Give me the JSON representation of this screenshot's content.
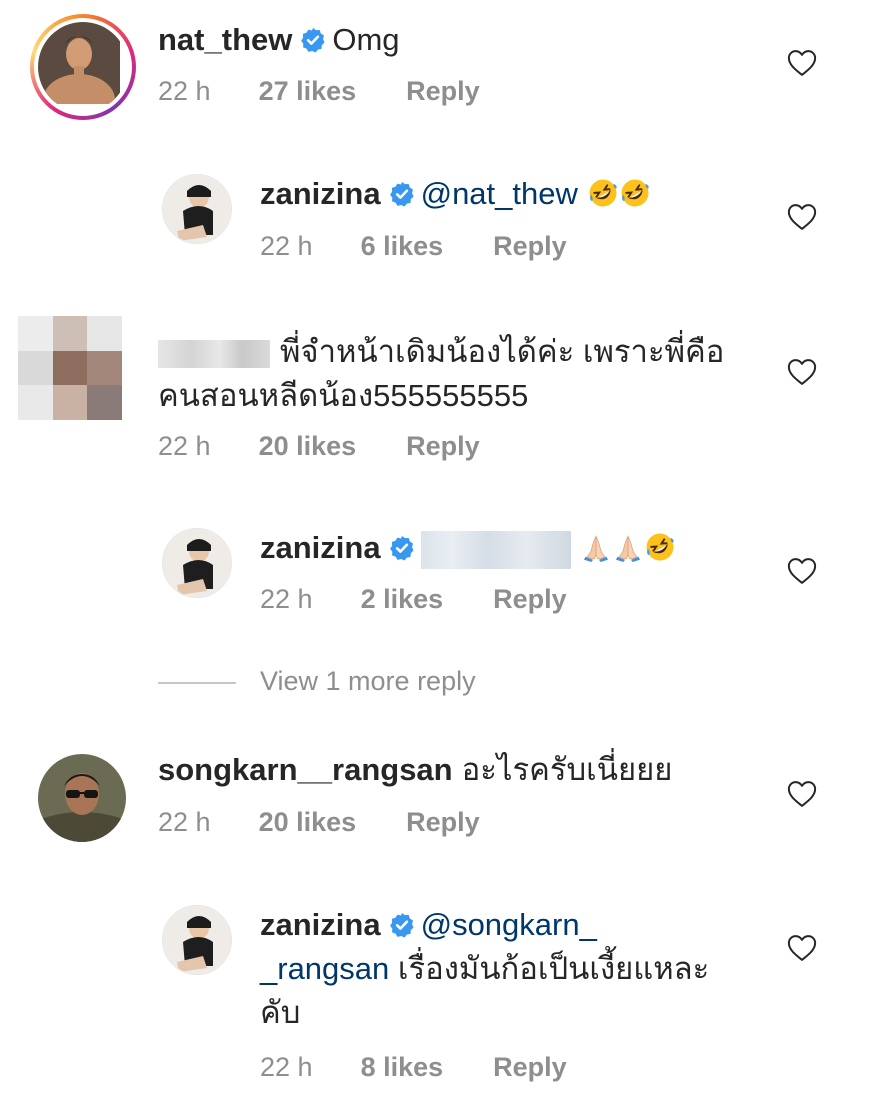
{
  "comments": [
    {
      "username": "nat_thew",
      "text": "Omg",
      "time": "22 h",
      "likes": "27 likes",
      "reply": "Reply"
    },
    {
      "username": "zanizina",
      "mention": "@nat_thew",
      "time": "22 h",
      "likes": "6 likes",
      "reply": "Reply",
      "emojis": [
        "rolling-on-floor-laughing",
        "rolling-on-floor-laughing"
      ]
    },
    {
      "text_line1": "พี่จำหน้าเดิมน้องได้ค่ะ เพราะพี่คือ",
      "text_line2": "คนสอนหลีดน้อง555555555",
      "time": "22 h",
      "likes": "20 likes",
      "reply": "Reply"
    },
    {
      "username": "zanizina",
      "time": "22 h",
      "likes": "2 likes",
      "reply": "Reply",
      "emojis": [
        "folded-hands",
        "folded-hands",
        "rolling-on-floor-laughing"
      ]
    },
    {
      "username": "songkarn__rangsan",
      "text": "อะไรครับเนี่ยยย",
      "time": "22 h",
      "likes": "20 likes",
      "reply": "Reply"
    },
    {
      "username": "zanizina",
      "mention_line1": "@songkarn_",
      "mention_line2": "_rangsan",
      "text_line2": " เรื่องมันก้อเป็นเงี้ยแหละ",
      "text_line3": "คับ",
      "time": "22 h",
      "likes": "8 likes",
      "reply": "Reply"
    }
  ],
  "view_more": "View 1 more reply",
  "icons": {
    "verified": "verified-badge-icon",
    "heart": "heart-outline-icon"
  },
  "colors": {
    "verified": "#3897f0",
    "mention": "#00376b",
    "meta": "#8e8e8e"
  }
}
